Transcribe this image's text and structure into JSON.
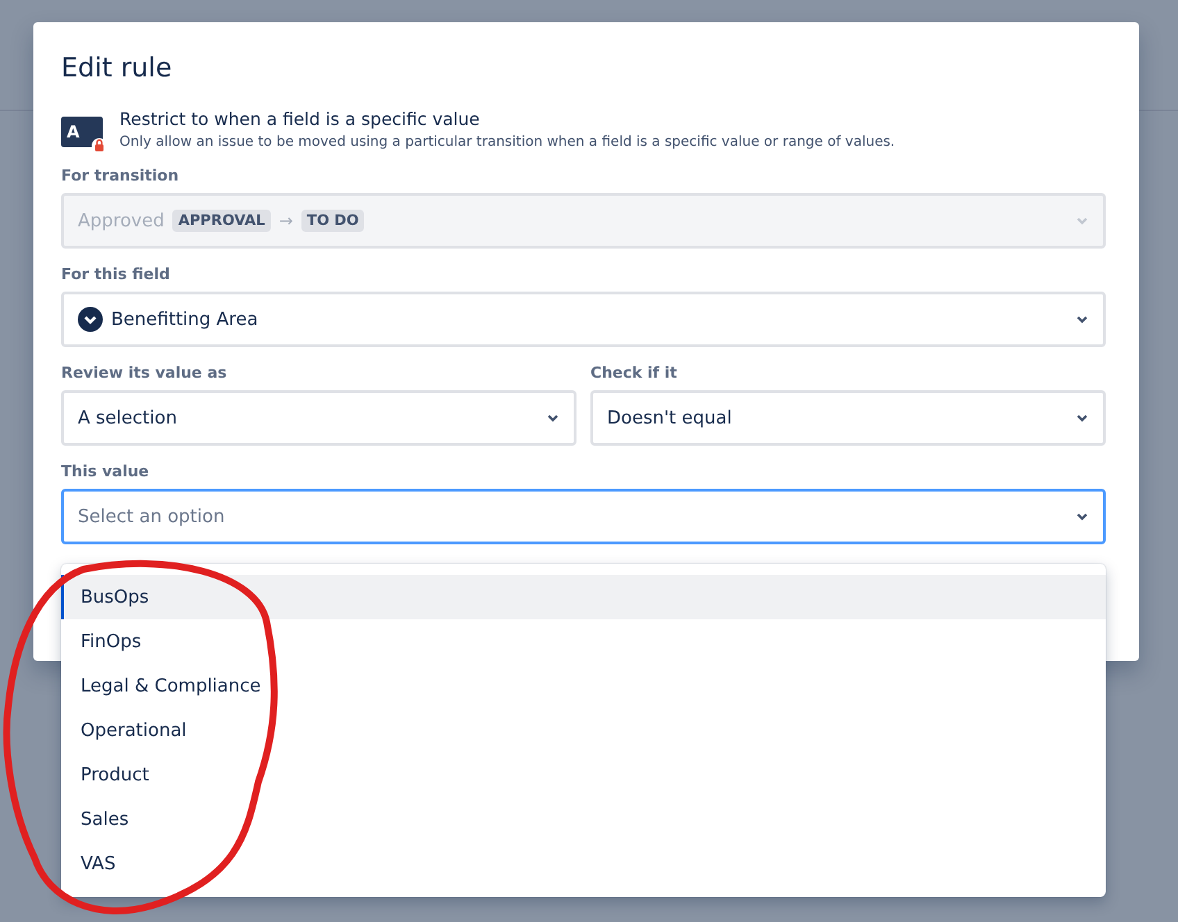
{
  "dialog": {
    "title": "Edit rule",
    "rule": {
      "icon_letter": "A",
      "title": "Restrict to when a field is a specific value",
      "description": "Only allow an issue to be moved using a particular transition when a field is a specific value or range of values."
    },
    "transition": {
      "label": "For transition",
      "from": "Approved",
      "from_status": "APPROVAL",
      "arrow": "→",
      "to_status": "TO DO",
      "disabled": true
    },
    "field": {
      "label": "For this field",
      "value": "Benefitting Area"
    },
    "review": {
      "label": "Review its value as",
      "value": "A selection"
    },
    "check": {
      "label": "Check if it",
      "value": "Doesn't equal"
    },
    "this_value": {
      "label": "This value",
      "placeholder": "Select an option",
      "focused": true
    }
  },
  "options": [
    {
      "label": "BusOps",
      "selected": true
    },
    {
      "label": "FinOps",
      "selected": false
    },
    {
      "label": "Legal & Compliance",
      "selected": false
    },
    {
      "label": "Operational",
      "selected": false
    },
    {
      "label": "Product",
      "selected": false
    },
    {
      "label": "Sales",
      "selected": false
    },
    {
      "label": "VAS",
      "selected": false
    }
  ]
}
